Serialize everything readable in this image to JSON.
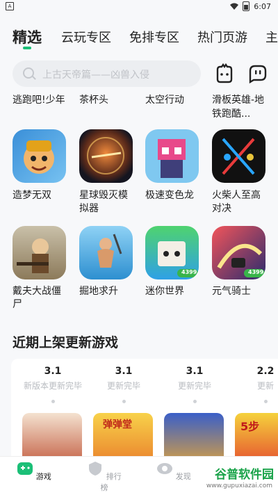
{
  "status": {
    "time": "6:07"
  },
  "tabs": [
    "精选",
    "云玩专区",
    "免排专区",
    "热门页游",
    "主"
  ],
  "search": {
    "placeholder": "上古天帝篇——凶兽入侵"
  },
  "partial_row": [
    "逃跑吧!少年",
    "茶杯头",
    "太空行动",
    "滑板英雄-地铁跑酷..."
  ],
  "row1": [
    {
      "name": "造梦无双",
      "icon": "warrior-monkey-icon"
    },
    {
      "name": "星球毁灭模拟器",
      "icon": "exploding-planet-icon"
    },
    {
      "name": "极速变色龙",
      "icon": "pink-robot-icon"
    },
    {
      "name": "火柴人至高对决",
      "icon": "stickman-duel-icon"
    }
  ],
  "row2": [
    {
      "name": "戴夫大战僵尸",
      "icon": "dave-shotgun-icon"
    },
    {
      "name": "掘地求升",
      "icon": "climbing-man-icon"
    },
    {
      "name": "迷你世界",
      "icon": "mini-world-icon",
      "badge": "4399"
    },
    {
      "name": "元气骑士",
      "icon": "knight-track-icon",
      "badge": "4399"
    }
  ],
  "section": {
    "title": "近期上架更新游戏"
  },
  "timeline": [
    {
      "date": "3.1",
      "label": "新版本更新完毕"
    },
    {
      "date": "3.1",
      "label": "更新完毕"
    },
    {
      "date": "3.1",
      "label": "更新完毕"
    },
    {
      "date": "2.2",
      "label": "更新"
    }
  ],
  "thumbs": [
    {
      "icon": "heroine-art-icon"
    },
    {
      "icon": "monkey-game-icon",
      "text": "弹弹堂"
    },
    {
      "icon": "armored-hero-icon"
    },
    {
      "icon": "number-game-icon",
      "text": "5步"
    }
  ],
  "nav": [
    {
      "label": "游戏",
      "icon": "gamepad-icon",
      "active": true
    },
    {
      "label": "排行榜",
      "icon": "shield-rank-icon",
      "active": false
    },
    {
      "label": "发现",
      "icon": "eye-discover-icon",
      "active": false
    }
  ],
  "watermark": {
    "title": "谷普软件园",
    "url": "www.gupuxiazai.com"
  },
  "colors": {
    "accent": "#1bbf77",
    "bg": "#f7f8fa"
  }
}
